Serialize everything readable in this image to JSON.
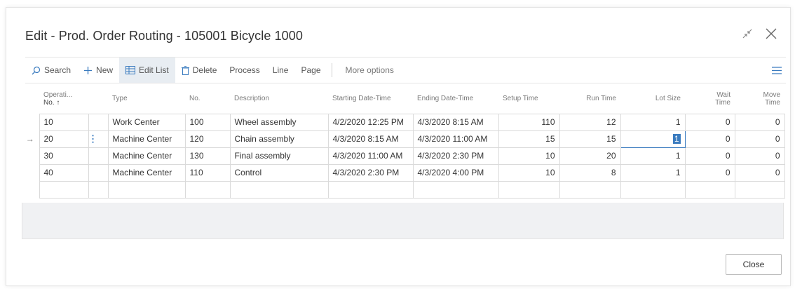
{
  "dialog": {
    "title": "Edit - Prod. Order Routing - 105001 Bicycle 1000"
  },
  "actions": {
    "search": "Search",
    "new": "New",
    "edit_list": "Edit List",
    "delete": "Delete",
    "process": "Process",
    "line": "Line",
    "page": "Page",
    "more_options": "More options"
  },
  "grid": {
    "headers": {
      "operation_no_1": "Operati...",
      "operation_no_2": "No. ↑",
      "type": "Type",
      "no": "No.",
      "description": "Description",
      "starting": "Starting Date-Time",
      "ending": "Ending Date-Time",
      "setup": "Setup Time",
      "run": "Run Time",
      "lot": "Lot Size",
      "wait_1": "Wait",
      "wait_2": "Time",
      "move_1": "Move",
      "move_2": "Time"
    },
    "rows": [
      {
        "op": "10",
        "type": "Work Center",
        "no": "100",
        "desc": "Wheel assembly",
        "start": "4/2/2020 12:25 PM",
        "end": "4/3/2020 8:15 AM",
        "setup": "110",
        "run": "12",
        "lot": "1",
        "wait": "0",
        "move": "0"
      },
      {
        "op": "20",
        "type": "Machine Center",
        "no": "120",
        "desc": "Chain assembly",
        "start": "4/3/2020 8:15 AM",
        "end": "4/3/2020 11:00 AM",
        "setup": "15",
        "run": "15",
        "lot": "1",
        "wait": "0",
        "move": "0"
      },
      {
        "op": "30",
        "type": "Machine Center",
        "no": "130",
        "desc": "Final assembly",
        "start": "4/3/2020 11:00 AM",
        "end": "4/3/2020 2:30 PM",
        "setup": "10",
        "run": "20",
        "lot": "1",
        "wait": "0",
        "move": "0"
      },
      {
        "op": "40",
        "type": "Machine Center",
        "no": "110",
        "desc": "Control",
        "start": "4/3/2020 2:30 PM",
        "end": "4/3/2020 4:00 PM",
        "setup": "10",
        "run": "8",
        "lot": "1",
        "wait": "0",
        "move": "0"
      }
    ],
    "current_row_marker": "→"
  },
  "footer": {
    "close": "Close"
  },
  "colors": {
    "accent": "#3a7bbf",
    "active_action_bg": "#e8edf2"
  }
}
